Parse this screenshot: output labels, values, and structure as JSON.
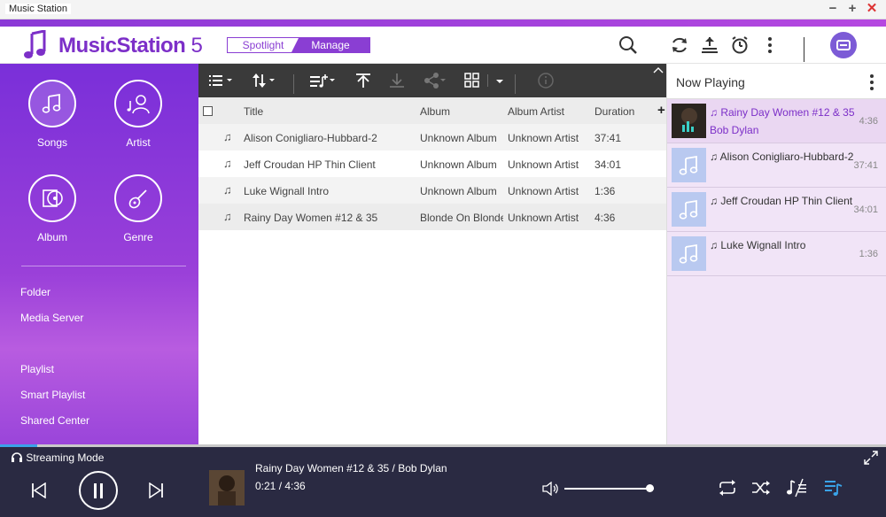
{
  "window": {
    "title": "Music Station"
  },
  "header": {
    "logo": "MusicStation",
    "logo_version": "5",
    "mode_spotlight": "Spotlight",
    "mode_manage": "Manage"
  },
  "sidebar": {
    "categories": [
      "Songs",
      "Artist",
      "Album",
      "Genre"
    ],
    "links": [
      "Folder",
      "Media Server",
      "Playlist",
      "Smart Playlist",
      "Shared Center"
    ]
  },
  "table": {
    "headers": {
      "title": "Title",
      "album": "Album",
      "album_artist": "Album Artist",
      "duration": "Duration"
    },
    "rows": [
      {
        "title": "Alison Conigliaro-Hubbard-2",
        "album": "Unknown Album",
        "album_artist": "Unknown Artist",
        "duration": "37:41"
      },
      {
        "title": "Jeff Croudan HP Thin Client",
        "album": "Unknown Album",
        "album_artist": "Unknown Artist",
        "duration": "34:01"
      },
      {
        "title": "Luke Wignall Intro",
        "album": "Unknown Album",
        "album_artist": "Unknown Artist",
        "duration": "1:36"
      },
      {
        "title": "Rainy Day Women #12 & 35",
        "album": "Blonde On Blonde",
        "album_artist": "Unknown Artist",
        "duration": "4:36"
      }
    ]
  },
  "now_playing": {
    "title": "Now Playing",
    "items": [
      {
        "name": "Rainy Day Women #12 & 35",
        "artist": "Bob Dylan",
        "duration": "4:36"
      },
      {
        "name": "Alison Conigliaro-Hubbard-2",
        "duration": "37:41"
      },
      {
        "name": "Jeff Croudan HP Thin Client",
        "duration": "34:01"
      },
      {
        "name": "Luke Wignall Intro",
        "duration": "1:36"
      }
    ]
  },
  "player": {
    "streaming_label": "Streaming Mode",
    "track": "Rainy Day Women #12 & 35 / Bob Dylan",
    "time": "0:21 / 4:36",
    "volume_fraction": 0.96
  },
  "colors": {
    "accent": "#7c2fc8",
    "player_bg": "#2a2a42",
    "progress": "#3aa3e8"
  }
}
